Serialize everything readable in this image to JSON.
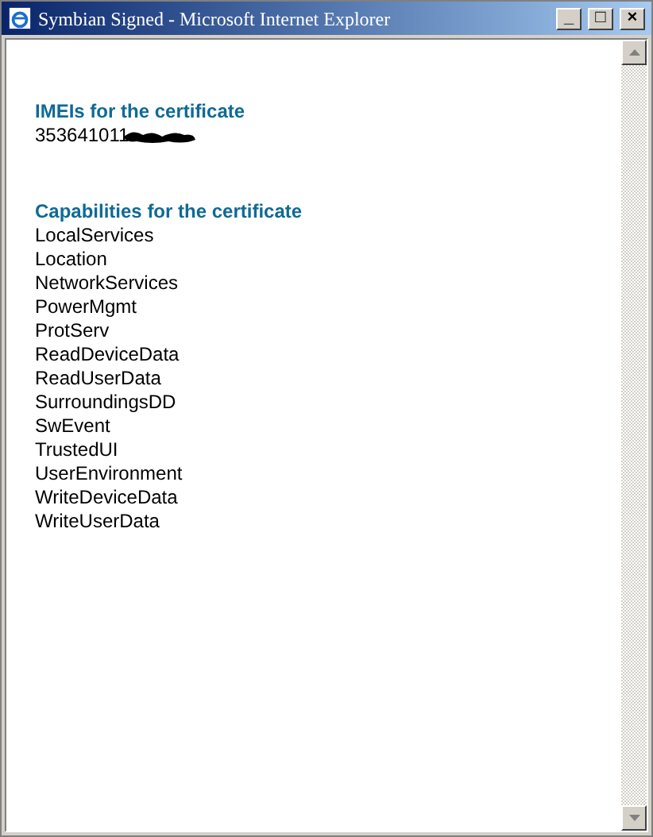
{
  "window": {
    "title": "Symbian Signed - Microsoft Internet Explorer",
    "controls": [
      "_",
      "□",
      "×"
    ]
  },
  "imei_section": {
    "heading": "IMEIs for the certificate",
    "imei": "353641011"
  },
  "capabilities_section": {
    "heading": "Capabilities for the certificate",
    "items": [
      "LocalServices",
      "Location",
      "NetworkServices",
      "PowerMgmt",
      "ProtServ",
      "ReadDeviceData",
      "ReadUserData",
      "SurroundingsDD",
      "SwEvent",
      "TrustedUI",
      "UserEnvironment",
      "WriteDeviceData",
      "WriteUserData"
    ]
  }
}
